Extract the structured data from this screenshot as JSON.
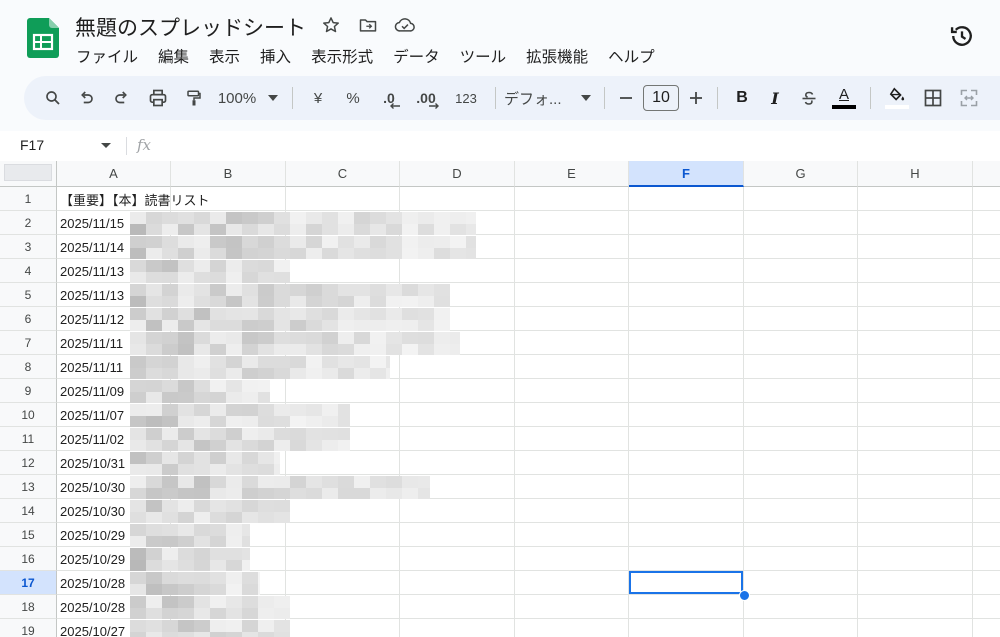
{
  "header": {
    "title": "無題のスプレッドシート",
    "menu": [
      "ファイル",
      "編集",
      "表示",
      "挿入",
      "表示形式",
      "データ",
      "ツール",
      "拡張機能",
      "ヘルプ"
    ]
  },
  "toolbar": {
    "zoom": "100%",
    "currency": "¥",
    "percent": "%",
    "decrease_decimal": ".0",
    "increase_decimal": ".00",
    "number_format": "123",
    "font": "デフォ...",
    "font_size": "10",
    "bold": "B",
    "italic": "I",
    "text_color": "A"
  },
  "formula_bar": {
    "name_box": "F17",
    "fx": "fx"
  },
  "grid": {
    "columns": [
      "A",
      "B",
      "C",
      "D",
      "E",
      "F",
      "G",
      "H"
    ],
    "selected_column": "F",
    "selected_row": "17",
    "rows": [
      {
        "row": "1",
        "a": "【重要】【本】読書リスト"
      },
      {
        "row": "2",
        "a": "2025/11/15"
      },
      {
        "row": "3",
        "a": "2025/11/14"
      },
      {
        "row": "4",
        "a": "2025/11/13"
      },
      {
        "row": "5",
        "a": "2025/11/13"
      },
      {
        "row": "6",
        "a": "2025/11/12"
      },
      {
        "row": "7",
        "a": "2025/11/11"
      },
      {
        "row": "8",
        "a": "2025/11/11"
      },
      {
        "row": "9",
        "a": "2025/11/09"
      },
      {
        "row": "10",
        "a": "2025/11/07"
      },
      {
        "row": "11",
        "a": "2025/11/02"
      },
      {
        "row": "12",
        "a": "2025/10/31"
      },
      {
        "row": "13",
        "a": "2025/10/30"
      },
      {
        "row": "14",
        "a": "2025/10/30"
      },
      {
        "row": "15",
        "a": "2025/10/29"
      },
      {
        "row": "16",
        "a": "2025/10/29"
      },
      {
        "row": "17",
        "a": "2025/10/28"
      },
      {
        "row": "18",
        "a": "2025/10/28"
      },
      {
        "row": "19",
        "a": "2025/10/27"
      }
    ]
  },
  "colors": {
    "accent": "#1a73e8",
    "sheets_green": "#0f9d58",
    "toolbar_bg": "#edf2fa",
    "selected_header": "#d3e3fd"
  }
}
